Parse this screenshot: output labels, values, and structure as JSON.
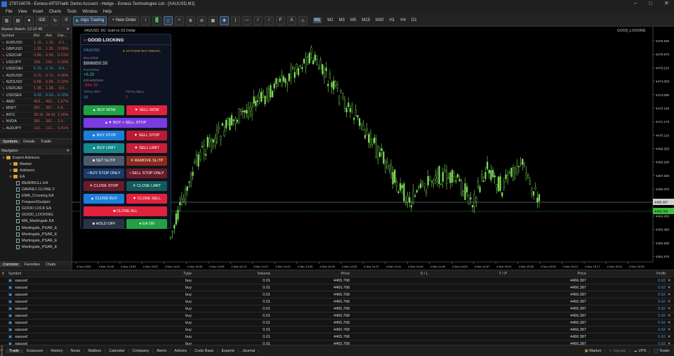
{
  "titlebar": {
    "text": "279714078 - Exness-MT5Trial8: Demo Account - Hedge - Exness Technologies Ltd - [XAUUSD,M1]"
  },
  "menu": [
    "File",
    "View",
    "Insert",
    "Charts",
    "Tools",
    "Window",
    "Help"
  ],
  "toolbar": {
    "ide": "IDE",
    "algo": "Algo Trading",
    "new_order": "New Order",
    "timeframes": [
      "M1",
      "M2",
      "M3",
      "M5",
      "M15",
      "M30",
      "H1",
      "H4",
      "D1"
    ],
    "active_tf": "M1"
  },
  "market_watch": {
    "title": "Market Watch: 12:12:48",
    "cols": [
      "Symbol",
      "Bid",
      "Ask",
      "Dai..."
    ],
    "rows": [
      {
        "s": "EURUSD",
        "b": "1.16...",
        "a": "1.16...",
        "d": "-0.1...",
        "dir": "down"
      },
      {
        "s": "GBPUSD",
        "b": "1.35...",
        "a": "1.35...",
        "d": "0.09%",
        "dir": "down"
      },
      {
        "s": "USDCHF",
        "b": "0.80...",
        "a": "0.80...",
        "d": "0.21%",
        "dir": "down"
      },
      {
        "s": "USDJPY",
        "b": "155....",
        "a": "155....",
        "d": "0.16%",
        "dir": "down"
      },
      {
        "s": "USDCNH",
        "b": "6.70...",
        "a": "6.70...",
        "d": "-0.0...",
        "dir": "up"
      },
      {
        "s": "AUDUSD",
        "b": "0.72...",
        "a": "0.72...",
        "d": "0.05%",
        "dir": "down"
      },
      {
        "s": "NZDUSD",
        "b": "0.58...",
        "a": "0.58...",
        "d": "0.12%",
        "dir": "down"
      },
      {
        "s": "USDCAD",
        "b": "1.38...",
        "a": "1.38...",
        "d": "-0.0...",
        "dir": "down"
      },
      {
        "s": "USDSEK",
        "b": "9.03...",
        "a": "9.03...",
        "d": "0.10%",
        "dir": "up"
      },
      {
        "s": "AMD",
        "b": "463....",
        "a": "463....",
        "d": "1.67%",
        "dir": "down"
      },
      {
        "s": "MSFT",
        "b": "397....",
        "a": "397....",
        "d": "5.6...",
        "dir": "down"
      },
      {
        "s": "INTC",
        "b": "28.16",
        "a": "28.42",
        "d": "2.26%",
        "dir": "down"
      },
      {
        "s": "NVDA",
        "b": "281....",
        "a": "281....",
        "d": "1.5...",
        "dir": "down"
      },
      {
        "s": "AUDJPY",
        "b": "112....",
        "a": "112....",
        "d": "0.41%",
        "dir": "down"
      }
    ],
    "tabs": [
      "Symbols",
      "Details",
      "Tradin"
    ]
  },
  "navigator": {
    "title": "Navigator",
    "items": [
      {
        "t": "Expert Advisors",
        "lvl": 0,
        "k": "folder"
      },
      {
        "t": "Market",
        "lvl": 1,
        "k": "folder"
      },
      {
        "t": "Advisors",
        "lvl": 1,
        "k": "folder"
      },
      {
        "t": "EA",
        "lvl": 1,
        "k": "folder"
      },
      {
        "t": "BEARBULL EA",
        "lvl": 2,
        "k": "doc"
      },
      {
        "t": "DAVRE1 CLONE 2",
        "lvl": 2,
        "k": "doc"
      },
      {
        "t": "EMA_Crossing EA",
        "lvl": 2,
        "k": "doc"
      },
      {
        "t": "FrequentScalper",
        "lvl": 2,
        "k": "doc"
      },
      {
        "t": "GOOD LOCK EA",
        "lvl": 2,
        "k": "doc"
      },
      {
        "t": "GOOD_LOCKING",
        "lvl": 2,
        "k": "doc"
      },
      {
        "t": "MA_Martingale EA",
        "lvl": 2,
        "k": "doc"
      },
      {
        "t": "Martingale_PSAR_E",
        "lvl": 2,
        "k": "doc"
      },
      {
        "t": "Martingale_PSAR_E",
        "lvl": 2,
        "k": "doc"
      },
      {
        "t": "Martingale_PSAR_E",
        "lvl": 2,
        "k": "doc"
      },
      {
        "t": "Martingale_PSAR_E",
        "lvl": 2,
        "k": "doc"
      }
    ],
    "tabs": [
      "Common",
      "Favorites",
      "Chats"
    ]
  },
  "chart": {
    "header": "XAUUSD, M1: Gold vs US Dollar",
    "ea_label": "GOOD_LOCKING",
    "price_ticks": [
      "4476.930",
      "4475.970",
      "4475.010",
      "4474.050",
      "4473.090",
      "4472.130",
      "4471.170",
      "4470.210",
      "4469.250",
      "4468.290",
      "4467.330",
      "4466.370",
      "4465.410",
      "4464.450",
      "4463.490",
      "4462.530",
      "4461.570"
    ],
    "current_price": "4466.367",
    "current_price_tag": "4465.768",
    "time_ticks": [
      "4 Nov 2025",
      "4 Nov 13:49",
      "4 Nov 13:53",
      "4 Nov 13:57",
      "4 Nov 14:01",
      "4 Nov 14:05",
      "4 Nov 14:09",
      "4 Nov 14:13",
      "4 Nov 14:17",
      "4 Nov 14:21",
      "4 Nov 14:25",
      "4 Nov 14:29",
      "4 Nov 14:33",
      "4 Nov 14:37",
      "4 Nov 14:41",
      "4 Nov 14:45",
      "4 Nov 14:49",
      "4 Nov 14:53",
      "4 Nov 14:57",
      "4 Nov 15:01",
      "4 Nov 15:05",
      "4 Nov 15:09",
      "4 Nov 15:13",
      "4 Nov 15:17",
      "4 Nov 15:21",
      "4 Nov 15:25"
    ]
  },
  "panel": {
    "title": "GOOD LOCKING",
    "symbol": "XAUUSD",
    "status": "● 10 POSISI BUY DIBUKA",
    "balance_label": "BALANCE",
    "balance": "$998850.50",
    "floating_label": "FLOATING",
    "floating": "+6.20",
    "drawdown_label": "DRAWDOWN",
    "drawdown": "-$64.39",
    "total_buy_label": "TOTAL BUY",
    "total_buy": "10",
    "total_sell_label": "TOTAL SELL",
    "total_sell": "0",
    "buttons": {
      "buy_now": "▲ BUY NOW",
      "sell_now": "▼ SELL NOW",
      "buy_sell_stop": "▲▼ BUY + SELL STOP",
      "buy_stop": "▲ BUY STOP",
      "sell_stop": "▼ SELL STOP",
      "buy_limit": "▲ BUY LIMIT",
      "sell_limit": "▼ SELL LIMIT",
      "set_sltp": "■ SET SL/TP",
      "remove_sltp": "✕ REMOVE SL/TP",
      "buy_stop_only": "• BUY STOP ONLY",
      "sell_stop_only": "• SELL STOP ONLY",
      "close_stop": "✕ CLOSE STOP",
      "close_limit": "✕ CLOSE LIMIT",
      "close_buy": "▲ CLOSE BUY",
      "close_sell": "▼ CLOSE SELL",
      "close_all": "■ CLOSE ALL",
      "hold_off": "■ HOLD OFF",
      "ea_on": "● EA ON"
    }
  },
  "trades": {
    "cols": [
      "Symbol",
      "Type",
      "Volume",
      "Price",
      "S / L",
      "T / P",
      "Price",
      "Profit"
    ],
    "rows": [
      {
        "symbol": "xauusd",
        "type": "buy",
        "volume": "0.01",
        "price": "4465.768",
        "sl": "",
        "tp": "",
        "cur": "4466.387",
        "profit": "0.62"
      },
      {
        "symbol": "xauusd",
        "type": "buy",
        "volume": "0.01",
        "price": "4465.768",
        "sl": "",
        "tp": "",
        "cur": "4466.387",
        "profit": "0.62"
      },
      {
        "symbol": "xauusd",
        "type": "buy",
        "volume": "0.01",
        "price": "4465.768",
        "sl": "",
        "tp": "",
        "cur": "4466.387",
        "profit": "0.62"
      },
      {
        "symbol": "xauusd",
        "type": "buy",
        "volume": "0.01",
        "price": "4465.768",
        "sl": "",
        "tp": "",
        "cur": "4466.387",
        "profit": "0.62"
      },
      {
        "symbol": "xauusd",
        "type": "buy",
        "volume": "0.01",
        "price": "4465.768",
        "sl": "",
        "tp": "",
        "cur": "4466.387",
        "profit": "0.62"
      },
      {
        "symbol": "xauusd",
        "type": "buy",
        "volume": "0.01",
        "price": "4465.768",
        "sl": "",
        "tp": "",
        "cur": "4466.387",
        "profit": "0.62"
      },
      {
        "symbol": "xauusd",
        "type": "buy",
        "volume": "0.01",
        "price": "4465.768",
        "sl": "",
        "tp": "",
        "cur": "4466.387",
        "profit": "0.62"
      },
      {
        "symbol": "xauusd",
        "type": "buy",
        "volume": "0.01",
        "price": "4465.768",
        "sl": "",
        "tp": "",
        "cur": "4466.387",
        "profit": "0.62"
      },
      {
        "symbol": "xauusd",
        "type": "buy",
        "volume": "0.01",
        "price": "4465.768",
        "sl": "",
        "tp": "",
        "cur": "4466.387",
        "profit": "0.62"
      },
      {
        "symbol": "xauusd",
        "type": "buy",
        "volume": "0.01",
        "price": "4465.768",
        "sl": "",
        "tp": "",
        "cur": "4466.387",
        "profit": "0.62"
      }
    ]
  },
  "bottom_tabs": [
    "Trade",
    "Exposure",
    "History",
    "News",
    "Mailbox",
    "Calendar",
    "Company",
    "Alerts",
    "Articles",
    "Code Base",
    "Experts",
    "Journal"
  ],
  "status_right": [
    "Market",
    "Signals",
    "VPS",
    "Tester"
  ],
  "toolbox_label": "Toolbox",
  "colors": {
    "bull": "#7ee05a",
    "bear": "#7ee05a",
    "buy": "#1e7fd8",
    "sell": "#e0223c",
    "purple": "#7a3be0",
    "teal": "#168a8a",
    "green": "#22a046"
  }
}
